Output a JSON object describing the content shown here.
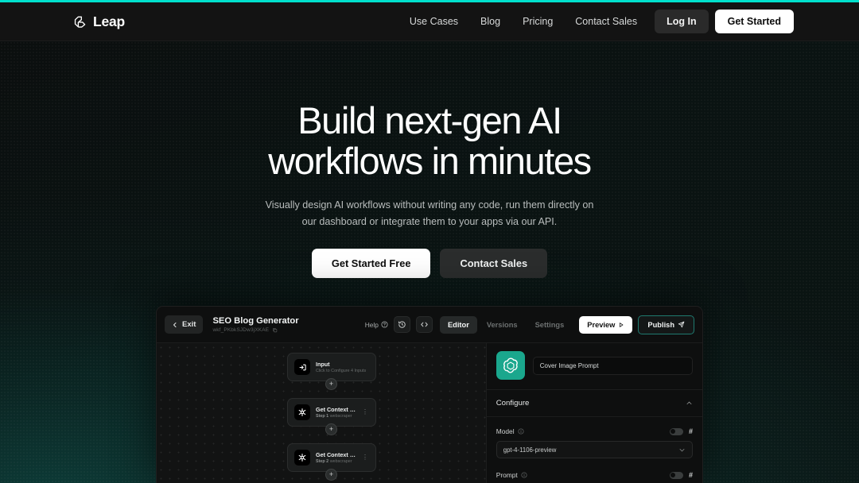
{
  "theme": {
    "accent_bar": "#00e0cc",
    "brand_teal": "#1aa78d",
    "publish_border": "#1f7a6f",
    "page_bg": "#090b0b"
  },
  "header": {
    "brand": {
      "name": "Leap",
      "logo_icon": "leap-cube-icon"
    },
    "nav": [
      {
        "label": "Use Cases"
      },
      {
        "label": "Blog"
      },
      {
        "label": "Pricing"
      },
      {
        "label": "Contact Sales"
      }
    ],
    "login_label": "Log In",
    "get_started_label": "Get Started"
  },
  "hero": {
    "title_line1": "Build next-gen AI",
    "title_line2": "workflows in minutes",
    "subtitle": "Visually design AI workflows without writing any code, run them directly on our dashboard or integrate them to your apps via our API.",
    "cta_primary": "Get Started Free",
    "cta_secondary": "Contact Sales"
  },
  "app_preview": {
    "toolbar": {
      "exit_label": "Exit",
      "exit_icon": "arrow-left-icon",
      "workflow_title": "SEO Blog Generator",
      "workflow_id": "wkf_PKbkSJDw3jXKAE",
      "copy_icon": "copy-icon",
      "help_label": "Help",
      "help_icon": "question-circle-icon",
      "history_icon": "history-clock-icon",
      "code_icon": "code-brackets-icon",
      "tabs": [
        {
          "label": "Editor",
          "active": true
        },
        {
          "label": "Versions",
          "active": false
        },
        {
          "label": "Settings",
          "active": false
        }
      ],
      "preview_label": "Preview",
      "preview_icon": "play-icon",
      "publish_label": "Publish",
      "publish_icon": "send-plane-icon"
    },
    "canvas": {
      "add_icon": "plus-icon",
      "menu_icon": "dots-vertical-icon",
      "nodes": [
        {
          "title": "Input",
          "subtitle": "Click to Configure 4 Inputs",
          "step": "",
          "icon": "input-arrow-icon",
          "has_menu": false
        },
        {
          "title": "Get Context from ...",
          "step": "Step 1",
          "subtitle": "webscraper",
          "icon": "webscraper-asterisk-icon",
          "has_menu": true
        },
        {
          "title": "Get Context from B...",
          "step": "Step 2",
          "subtitle": "webscraper",
          "icon": "webscraper-asterisk-icon",
          "has_menu": true
        }
      ]
    },
    "config_panel": {
      "provider_icon": "openai-logo-icon",
      "node_name_value": "Cover Image Prompt",
      "node_name_placeholder": "Cover Image Prompt",
      "section_title": "Configure",
      "collapse_icon": "chevron-up-icon",
      "fields": [
        {
          "label": "Model",
          "info_icon": "info-circle-icon",
          "toggle_icon": "toggle-off-icon",
          "hash_icon": "hash-icon",
          "value": "gpt-4-1106-preview",
          "chevron_icon": "chevron-down-icon"
        },
        {
          "label": "Prompt",
          "info_icon": "info-circle-icon",
          "toggle_icon": "toggle-off-icon",
          "hash_icon": "hash-icon"
        }
      ]
    }
  }
}
